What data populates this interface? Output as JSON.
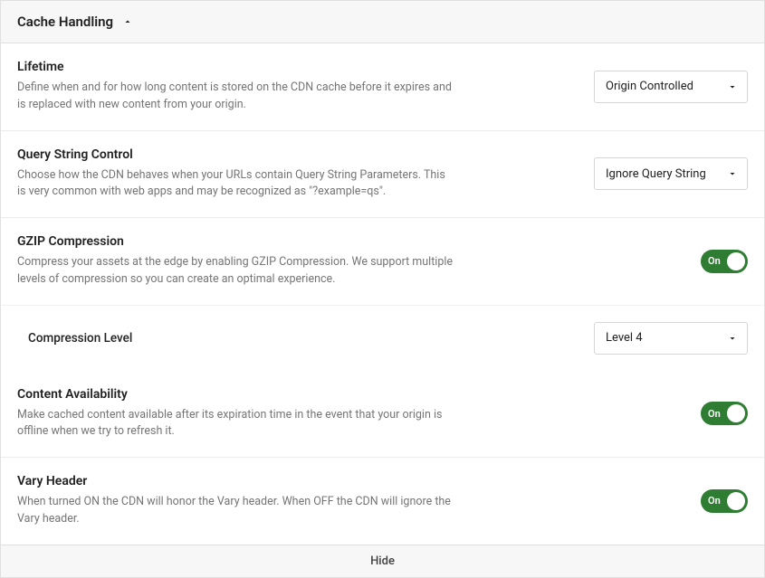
{
  "header": {
    "title": "Cache Handling"
  },
  "settings": {
    "lifetime": {
      "title": "Lifetime",
      "desc": "Define when and for how long content is stored on the CDN cache before it expires and is replaced with new content from your origin.",
      "value": "Origin Controlled"
    },
    "queryString": {
      "title": "Query String Control",
      "desc": "Choose how the CDN behaves when your URLs contain Query String Parameters. This is very common with web apps and may be recognized as \"?example=qs\".",
      "value": "Ignore Query String"
    },
    "gzip": {
      "title": "GZIP Compression",
      "desc": "Compress your assets at the edge by enabling GZIP Compression. We support multiple levels of compression so you can create an optimal experience.",
      "toggleLabel": "On"
    },
    "compressionLevel": {
      "title": "Compression Level",
      "value": "Level 4"
    },
    "contentAvailability": {
      "title": "Content Availability",
      "desc": "Make cached content available after its expiration time in the event that your origin is offline when we try to refresh it.",
      "toggleLabel": "On"
    },
    "varyHeader": {
      "title": "Vary Header",
      "desc": "When turned ON the CDN will honor the Vary header. When OFF the CDN will ignore the Vary header.",
      "toggleLabel": "On"
    }
  },
  "footer": {
    "hide": "Hide"
  }
}
